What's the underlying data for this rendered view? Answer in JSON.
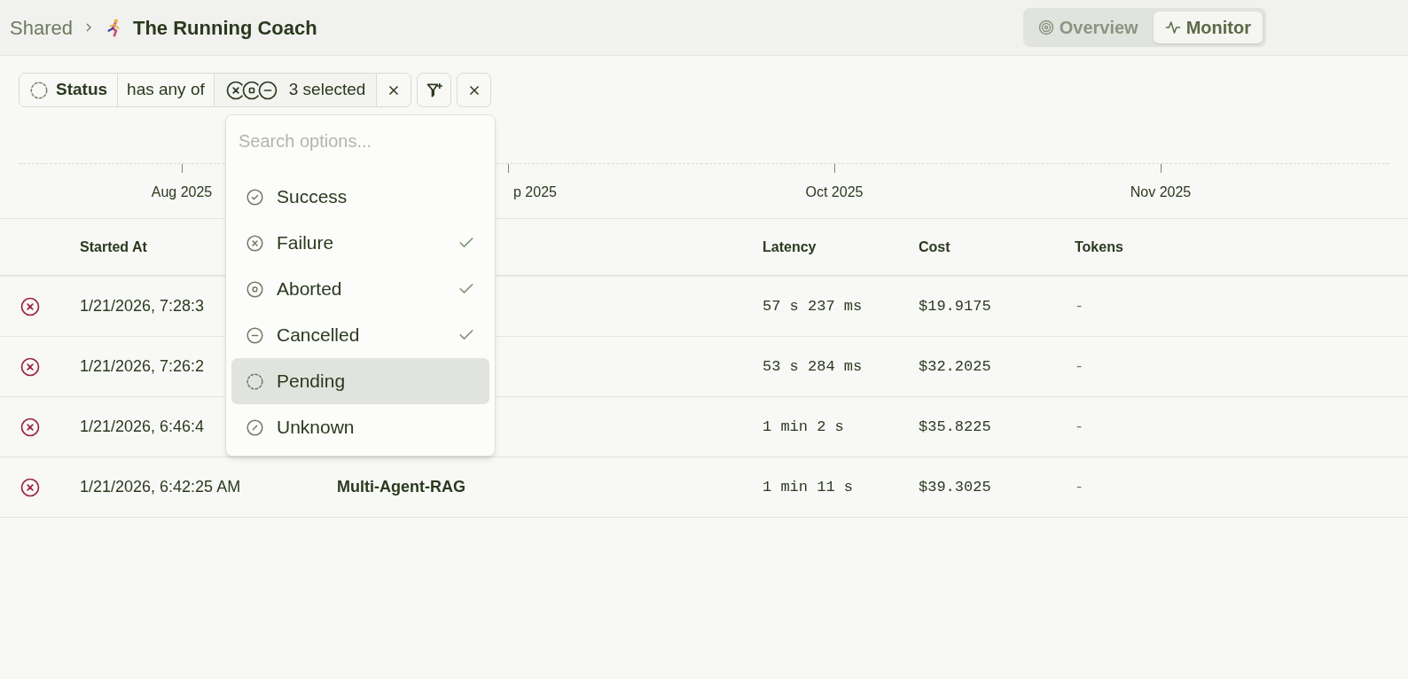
{
  "breadcrumb": {
    "parent": "Shared",
    "title": "The Running Coach"
  },
  "view_tabs": [
    {
      "label": "Overview",
      "kind": "target",
      "selected": false
    },
    {
      "label": "Monitor",
      "kind": "activity",
      "selected": true
    }
  ],
  "filter": {
    "field": "Status",
    "operator": "has any of",
    "value": "3 selected",
    "value_icons": [
      {
        "kind": "failure"
      },
      {
        "kind": "aborted"
      },
      {
        "kind": "cancelled"
      }
    ]
  },
  "timeline": {
    "ticks": [
      {
        "label": "Aug 2025",
        "cut_left": false
      },
      {
        "label": "p 2025",
        "cut_left": true
      },
      {
        "label": "Oct 2025",
        "cut_left": false
      },
      {
        "label": "Nov 2025",
        "cut_left": false
      }
    ]
  },
  "table": {
    "columns": [
      "Started At",
      "Latency",
      "Cost",
      "Tokens"
    ],
    "rows": [
      {
        "kind": "failure",
        "started_at": "1/21/2026, 7:28:3",
        "latency": "57 s 237 ms",
        "cost": "$19.9175",
        "tokens": "-"
      },
      {
        "kind": "failure",
        "started_at": "1/21/2026, 7:26:2",
        "latency": "53 s 284 ms",
        "cost": "$32.2025",
        "tokens": "-"
      },
      {
        "kind": "failure",
        "started_at": "1/21/2026, 6:46:4",
        "latency": "1 min 2 s",
        "cost": "$35.8225",
        "tokens": "-"
      },
      {
        "kind": "failure",
        "started_at": "1/21/2026, 6:42:25 AM",
        "column_3": "Multi-Agent-RAG",
        "latency": "1 min 11 s",
        "cost": "$39.3025",
        "tokens": "-"
      }
    ]
  },
  "dropdown": {
    "placeholder": "Search options...",
    "options": [
      {
        "label": "Success",
        "kind": "success",
        "checked": false,
        "highlighted": false
      },
      {
        "label": "Failure",
        "kind": "failure",
        "checked": true,
        "highlighted": false
      },
      {
        "label": "Aborted",
        "kind": "aborted",
        "checked": true,
        "highlighted": false
      },
      {
        "label": "Cancelled",
        "kind": "cancelled",
        "checked": true,
        "highlighted": false
      },
      {
        "label": "Pending",
        "kind": "pending",
        "checked": false,
        "highlighted": true
      },
      {
        "label": "Unknown",
        "kind": "unknown",
        "checked": false,
        "highlighted": false
      }
    ]
  }
}
